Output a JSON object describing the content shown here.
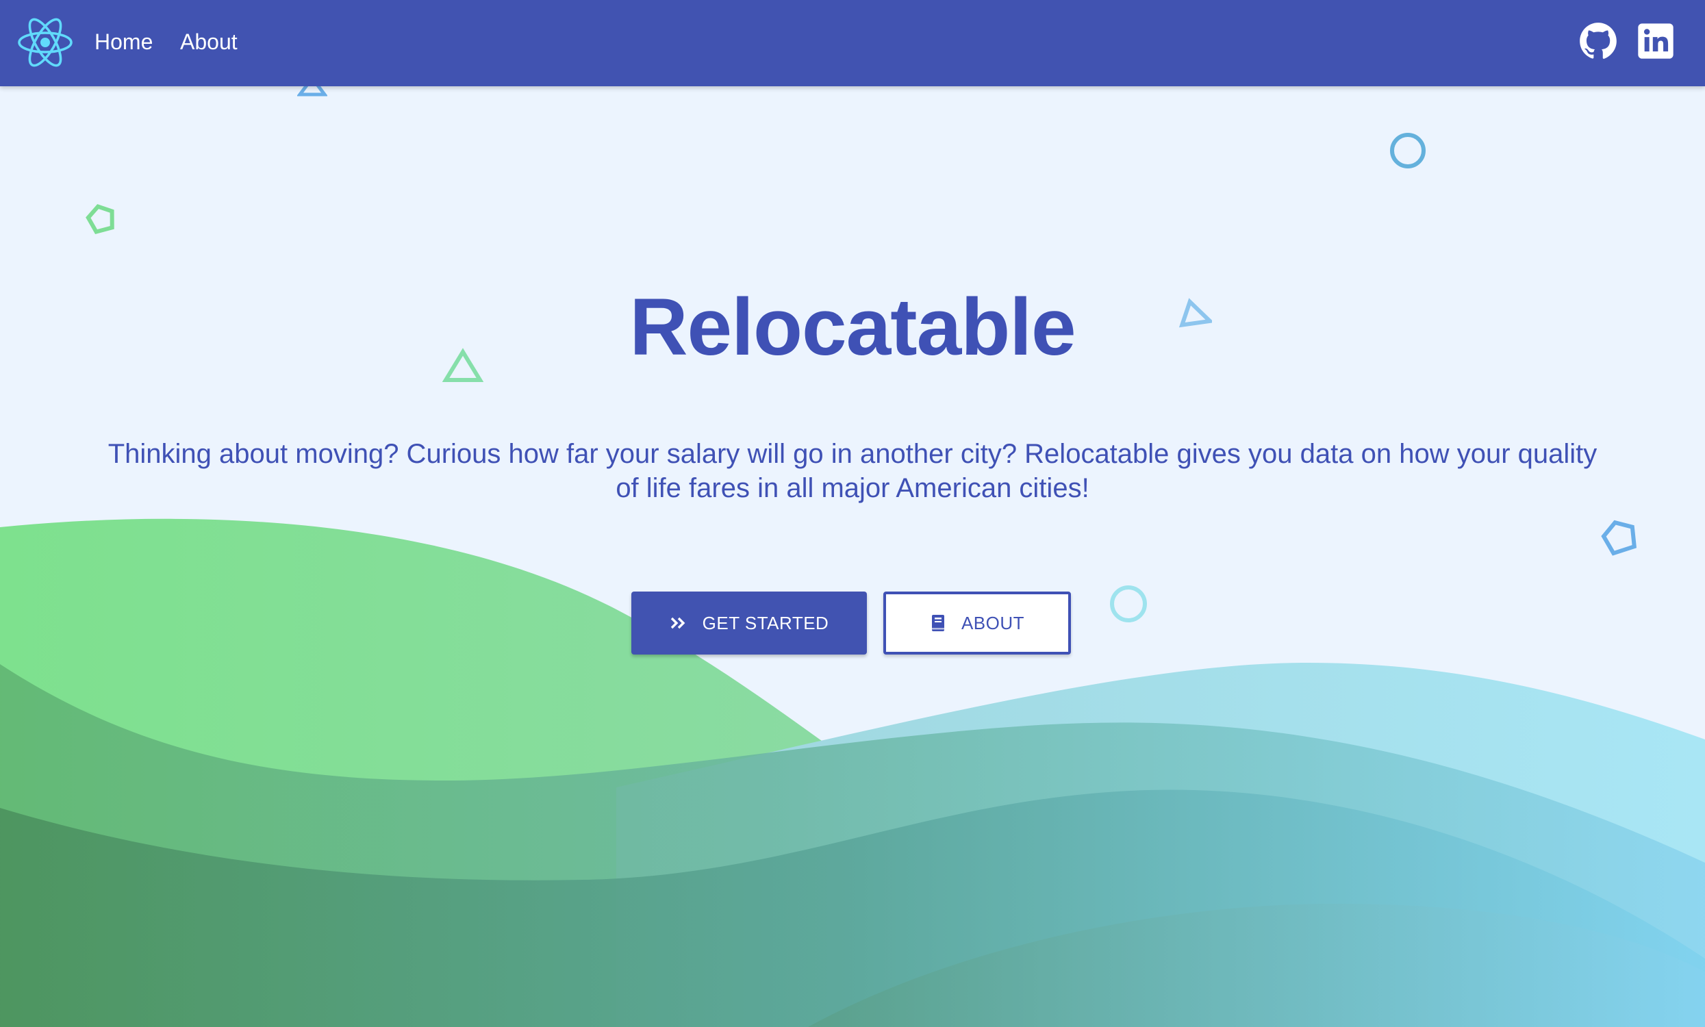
{
  "nav": {
    "logo_icon": "react-atom-icon",
    "home_label": "Home",
    "about_label": "About",
    "github_icon": "github-icon",
    "linkedin_icon": "linkedin-icon"
  },
  "hero": {
    "title": "Relocatable",
    "subtitle": "Thinking about moving? Curious how far your salary will go in another city? Relocatable gives you data on how your quality of life fares in all major American cities!",
    "get_started_label": "GET STARTED",
    "get_started_icon": "double-chevron-right-icon",
    "about_label": "ABOUT",
    "about_icon": "book-icon"
  },
  "colors": {
    "appbar": "#4153b1",
    "primary": "#3f51b5",
    "background": "#ecf4fe",
    "wave_green": "#7ddf8f",
    "wave_blue": "#8fd8ef"
  }
}
